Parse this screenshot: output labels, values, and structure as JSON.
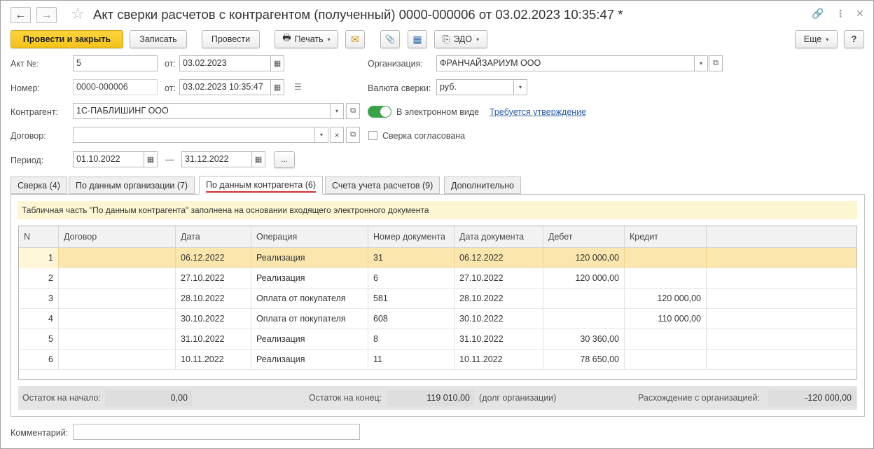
{
  "window": {
    "title": "Акт сверки расчетов с контрагентом (полученный) 0000-000006 от 03.02.2023 10:35:47 *",
    "back_icon": "←",
    "forward_icon": "→",
    "star_icon": "☆",
    "link_icon": "🔗",
    "menu_icon": "⋮",
    "close_icon": "✕"
  },
  "toolbar": {
    "post_close": "Провести и закрыть",
    "save": "Записать",
    "post": "Провести",
    "print": "Печать",
    "edo": "ЭДО",
    "more": "Еще",
    "help": "?",
    "print_icon": "🖶",
    "mail_icon": "✉",
    "attach_icon": "📎",
    "struct_icon": "▦",
    "edo_icon": "⎘",
    "arrow": "▾"
  },
  "form": {
    "act_no_label": "Акт №:",
    "act_no": "5",
    "from_label": "от:",
    "act_date": "03.02.2023",
    "number_label": "Номер:",
    "number": "0000-000006",
    "from_label2": "от:",
    "number_datetime": "03.02.2023 10:35:47",
    "org_label": "Организация:",
    "org": "ФРАНЧАЙЗАРИУМ ООО",
    "currency_label": "Валюта сверки:",
    "currency": "руб.",
    "counterparty_label": "Контрагент:",
    "counterparty": "1С-ПАБЛИШИНГ ООО",
    "electronic_label": "В электронном виде",
    "approval_link": "Требуется утверждение",
    "contract_label": "Договор:",
    "contract": "",
    "agreed_label": "Сверка согласована",
    "period_label": "Период:",
    "period_from": "01.10.2022",
    "dash": "—",
    "period_to": "31.12.2022",
    "ellipsis": "...",
    "comment_label": "Комментарий:",
    "comment": "",
    "clear_icon": "×",
    "open_icon": "⧉",
    "calendar_icon": "▦",
    "doc_icon": "☰"
  },
  "tabs": [
    {
      "label": "Сверка (4)"
    },
    {
      "label": "По данным организации (7)"
    },
    {
      "label": "По данным контрагента (6)"
    },
    {
      "label": "Счета учета расчетов (9)"
    },
    {
      "label": "Дополнительно"
    }
  ],
  "info_text": "Табличная часть \"По данным контрагента\" заполнена на основании входящего электронного документа",
  "table": {
    "headers": [
      "N",
      "Договор",
      "Дата",
      "Операция",
      "Номер документа",
      "Дата документа",
      "Дебет",
      "Кредит"
    ],
    "rows": [
      [
        "1",
        "",
        "06.12.2022",
        "Реализация",
        "31",
        "06.12.2022",
        "120 000,00",
        ""
      ],
      [
        "2",
        "",
        "27.10.2022",
        "Реализация",
        "6",
        "27.10.2022",
        "120 000,00",
        ""
      ],
      [
        "3",
        "",
        "28.10.2022",
        "Оплата от покупателя",
        "581",
        "28.10.2022",
        "",
        "120 000,00"
      ],
      [
        "4",
        "",
        "30.10.2022",
        "Оплата от покупателя",
        "608",
        "30.10.2022",
        "",
        "110 000,00"
      ],
      [
        "5",
        "",
        "31.10.2022",
        "Реализация",
        "8",
        "31.10.2022",
        "30 360,00",
        ""
      ],
      [
        "6",
        "",
        "10.11.2022",
        "Реализация",
        "11",
        "10.11.2022",
        "78 650,00",
        ""
      ]
    ]
  },
  "footer": {
    "start_label": "Остаток на начало:",
    "start_value": "0,00",
    "end_label": "Остаток на конец:",
    "end_value": "119 010,00",
    "end_note": "(долг организации)",
    "diff_label": "Расхождение с организацией:",
    "diff_value": "-120 000,00"
  },
  "colors": {
    "primary_button": "#f4c21a",
    "toggle_on": "#3aa349",
    "selected_row": "#fbe7ae",
    "info_bg": "#fdf6d3",
    "active_tab_underline": "#d32f2f",
    "link": "#2b5ea8"
  }
}
